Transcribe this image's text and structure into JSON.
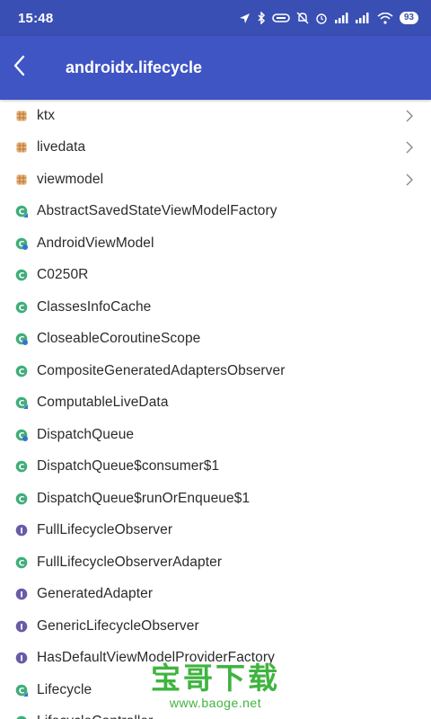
{
  "status_bar": {
    "time": "15:48",
    "battery": "93",
    "icons": [
      "location-icon",
      "bluetooth-icon",
      "link-icon",
      "silent-icon",
      "alarm-icon",
      "signal-icon",
      "signal-hd-icon",
      "wifi-icon",
      "battery-icon"
    ]
  },
  "app_bar": {
    "title": "androidx.lifecycle",
    "back_icon": "back-arrow-icon",
    "color": "#3f55c4"
  },
  "list": {
    "items": [
      {
        "type": "package",
        "label": "ktx",
        "chevron": true
      },
      {
        "type": "package",
        "label": "livedata",
        "chevron": true
      },
      {
        "type": "package",
        "label": "viewmodel",
        "chevron": true
      },
      {
        "type": "abstract-class",
        "label": "AbstractSavedStateViewModelFactory"
      },
      {
        "type": "class-special",
        "label": "AndroidViewModel"
      },
      {
        "type": "class",
        "label": "C0250R"
      },
      {
        "type": "class",
        "label": "ClassesInfoCache"
      },
      {
        "type": "class-special",
        "label": "CloseableCoroutineScope"
      },
      {
        "type": "class",
        "label": "CompositeGeneratedAdaptersObserver"
      },
      {
        "type": "abstract-class",
        "label": "ComputableLiveData"
      },
      {
        "type": "class-special",
        "label": "DispatchQueue"
      },
      {
        "type": "class",
        "label": "DispatchQueue$consumer$1"
      },
      {
        "type": "class",
        "label": "DispatchQueue$runOrEnqueue$1"
      },
      {
        "type": "interface",
        "label": "FullLifecycleObserver"
      },
      {
        "type": "class",
        "label": "FullLifecycleObserverAdapter"
      },
      {
        "type": "interface",
        "label": "GeneratedAdapter"
      },
      {
        "type": "interface",
        "label": "GenericLifecycleObserver"
      },
      {
        "type": "interface",
        "label": "HasDefaultViewModelProviderFactory"
      },
      {
        "type": "abstract-class",
        "label": "Lifecycle"
      },
      {
        "type": "class",
        "label": "LifecycleController"
      }
    ]
  },
  "watermark": {
    "main": "宝哥下载",
    "sub": "www.baoge.net"
  },
  "colors": {
    "status_bar": "#3a4fb3",
    "app_bar": "#3f55c4",
    "package_icon": "#d9a066",
    "class_icon": "#3fae7a",
    "interface_icon": "#6a5aa8",
    "accent_blue": "#3a6fd8",
    "watermark": "#3fb43f"
  }
}
